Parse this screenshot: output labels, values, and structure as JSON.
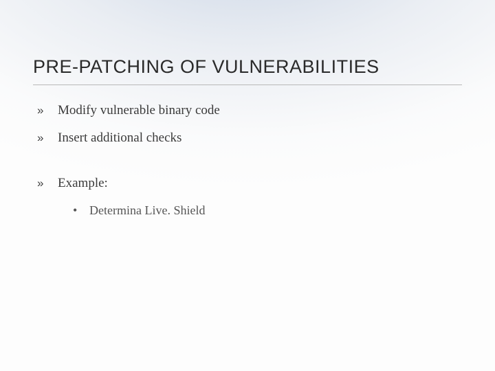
{
  "slide": {
    "title": "PRE-PATCHING OF VULNERABILITIES",
    "bullets": [
      {
        "marker": "»",
        "text": "Modify vulnerable binary code",
        "gap_before": false
      },
      {
        "marker": "»",
        "text": "Insert additional checks",
        "gap_before": false
      },
      {
        "marker": "»",
        "text": "Example:",
        "gap_before": true
      }
    ],
    "sub_bullets": [
      {
        "marker": "•",
        "text": "Determina Live. Shield"
      }
    ]
  }
}
